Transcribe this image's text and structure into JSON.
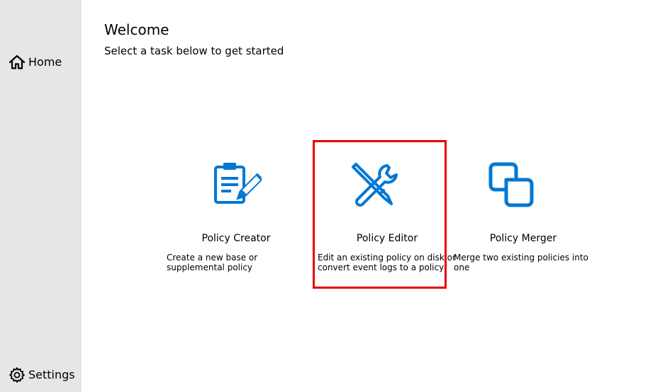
{
  "sidebar": {
    "home": {
      "label": "Home",
      "icon": "home-icon"
    },
    "settings": {
      "label": "Settings",
      "icon": "gear-icon"
    }
  },
  "main": {
    "title": "Welcome",
    "subtitle": "Select a task below to get started",
    "cards": [
      {
        "title": "Policy Creator",
        "description": "Create a new base or supplemental policy",
        "icon": "clipboard-pencil-icon"
      },
      {
        "title": "Policy Editor",
        "description": "Edit an existing policy on disk or convert event logs to a policy",
        "icon": "wrench-pencil-icon"
      },
      {
        "title": "Policy Merger",
        "description": "Merge two existing policies into one",
        "icon": "merge-squares-icon"
      }
    ],
    "selected_card": "Policy Editor"
  },
  "colors": {
    "accent": "#0078d4",
    "sidebar_bg": "#e6e6e6",
    "highlight": "#e60000"
  }
}
